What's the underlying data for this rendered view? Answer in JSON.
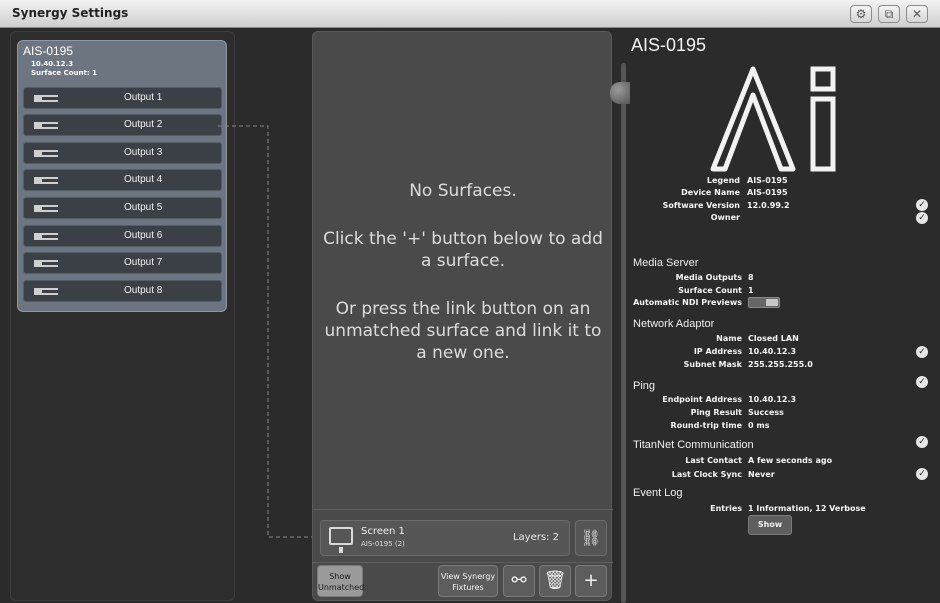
{
  "window": {
    "title": "Synergy Settings",
    "buttons": [
      {
        "name": "settings-window-button",
        "icon": "gear-icon",
        "glyph": "⚙"
      },
      {
        "name": "screenshot-window-button",
        "icon": "capture-icon",
        "glyph": "⧉"
      },
      {
        "name": "close-window-button",
        "icon": "close-icon",
        "glyph": "✕"
      }
    ]
  },
  "device": {
    "name": "AIS-0195",
    "ip": "10.40.12.3",
    "surface_count_label": "Surface Count: 1",
    "outputs": [
      {
        "label": "Output 1"
      },
      {
        "label": "Output 2"
      },
      {
        "label": "Output 3"
      },
      {
        "label": "Output 4"
      },
      {
        "label": "Output 5"
      },
      {
        "label": "Output 6"
      },
      {
        "label": "Output 7"
      },
      {
        "label": "Output 8"
      }
    ]
  },
  "surfaces": {
    "empty_title": "No Surfaces.",
    "empty_hint_1": "Click the '+' button below to add a surface.",
    "empty_hint_2": "Or press the link button on an unmatched surface and link it to a new one.",
    "card": {
      "name": "Screen 1",
      "sub": "AIS-0195 (2)",
      "layers": "Layers: 2"
    },
    "footer": {
      "show_unmatched": "Show Unmatched",
      "view_fixtures": "View Synergy Fixtures"
    }
  },
  "info": {
    "title": "AIS-0195",
    "general": [
      {
        "key": "Legend",
        "value": "AIS-0195"
      },
      {
        "key": "Device Name",
        "value": "AIS-0195"
      },
      {
        "key": "Software Version",
        "value": "12.0.99.2"
      },
      {
        "key": "Owner",
        "value": ""
      }
    ],
    "media_server": {
      "heading": "Media Server",
      "rows": [
        {
          "key": "Media Outputs",
          "value": "8"
        },
        {
          "key": "Surface Count",
          "value": "1"
        },
        {
          "key": "Automatic NDI Previews",
          "value": ""
        }
      ]
    },
    "network": {
      "heading": "Network Adaptor",
      "rows": [
        {
          "key": "Name",
          "value": "Closed LAN"
        },
        {
          "key": "IP Address",
          "value": "10.40.12.3"
        },
        {
          "key": "Subnet Mask",
          "value": "255.255.255.0"
        }
      ]
    },
    "ping": {
      "heading": "Ping",
      "rows": [
        {
          "key": "Endpoint Address",
          "value": "10.40.12.3"
        },
        {
          "key": "Ping Result",
          "value": "Success"
        },
        {
          "key": "Round-trip time",
          "value": "0 ms"
        }
      ]
    },
    "titannet": {
      "heading": "TitanNet Communication",
      "rows": [
        {
          "key": "Last Contact",
          "value": "A few seconds ago"
        },
        {
          "key": "Last Clock Sync",
          "value": "Never"
        }
      ]
    },
    "eventlog": {
      "heading": "Event Log",
      "rows": [
        {
          "key": "Entries",
          "value": "1 Information, 12 Verbose"
        }
      ],
      "show_label": "Show"
    },
    "check_glyph": "✓"
  }
}
